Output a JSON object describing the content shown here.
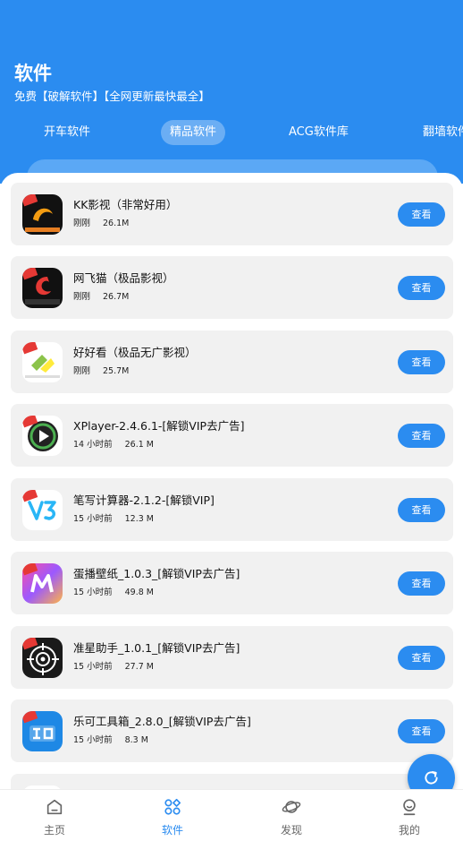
{
  "page": {
    "title": "软件",
    "subtitle": "免费【破解软件】【全网更新最快最全】"
  },
  "tabs": [
    {
      "label": "开车软件",
      "active": false
    },
    {
      "label": "精品软件",
      "active": true
    },
    {
      "label": "ACG软件库",
      "active": false
    },
    {
      "label": "翻墙软件",
      "active": false
    }
  ],
  "apps": [
    {
      "name": "KK影视（非常好用）",
      "time": "刚刚",
      "size": "26.1M",
      "button": "查看",
      "icon": "kk-video-icon"
    },
    {
      "name": "网飞猫（极品影视）",
      "time": "刚刚",
      "size": "26.7M",
      "button": "查看",
      "icon": "netflix-cat-icon"
    },
    {
      "name": "好好看（极品无广影视）",
      "time": "刚刚",
      "size": "25.7M",
      "button": "查看",
      "icon": "haohaokan-icon"
    },
    {
      "name": "XPlayer-2.4.6.1-[解锁VIP去广告]",
      "time": "14 小时前",
      "size": "26.1 M",
      "button": "查看",
      "icon": "xplayer-icon"
    },
    {
      "name": "笔写计算器-2.1.2-[解锁VIP]",
      "time": "15 小时前",
      "size": "12.3 M",
      "button": "查看",
      "icon": "calculator-v3-icon"
    },
    {
      "name": "蛋播壁纸_1.0.3_[解锁VIP去广告]",
      "time": "15 小时前",
      "size": "49.8 M",
      "button": "查看",
      "icon": "wallpaper-icon"
    },
    {
      "name": "准星助手_1.0.1_[解锁VIP去广告]",
      "time": "15 小时前",
      "size": "27.7 M",
      "button": "查看",
      "icon": "crosshair-icon"
    },
    {
      "name": "乐可工具箱_2.8.0_[解锁VIP去广告]",
      "time": "15 小时前",
      "size": "8.3 M",
      "button": "查看",
      "icon": "leke-toolbox-icon"
    }
  ],
  "bottom_nav": [
    {
      "label": "主页",
      "icon": "home-icon",
      "active": false
    },
    {
      "label": "软件",
      "icon": "apps-grid-icon",
      "active": true
    },
    {
      "label": "发现",
      "icon": "planet-icon",
      "active": false
    },
    {
      "label": "我的",
      "icon": "profile-icon",
      "active": false
    }
  ],
  "colors": {
    "accent": "#2b8cf0",
    "card": "#f1f1f1",
    "badge": "#e53935"
  }
}
